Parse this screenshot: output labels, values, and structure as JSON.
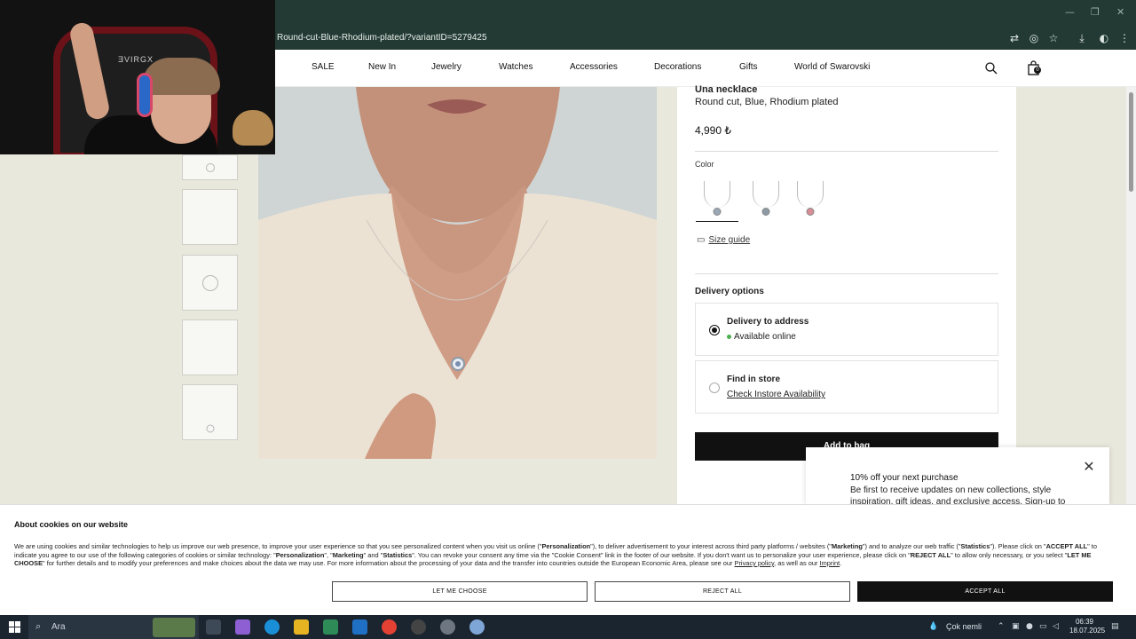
{
  "browser": {
    "url": "Round-cut-Blue-Rhodium-plated/?variantID=5279425",
    "window_controls": {
      "minimize": "—",
      "restore": "❐",
      "close": "✕"
    }
  },
  "nav": {
    "items": [
      "SALE",
      "New In",
      "Jewelry",
      "Watches",
      "Accessories",
      "Decorations",
      "Gifts",
      "World of Swarovski"
    ],
    "bag_count": "0"
  },
  "webcam": {
    "chair_brand": "ƎVIRGX"
  },
  "product": {
    "name": "Una necklace",
    "variant": "Round cut, Blue, Rhodium plated",
    "price": "4,990 ₺",
    "color_label": "Color",
    "swatch_colors": [
      "#9aa7b6",
      "#8e9aa3",
      "#d88d96"
    ],
    "size_guide": "Size guide",
    "delivery_label": "Delivery options",
    "delivery": [
      {
        "title": "Delivery to address",
        "sub": "Available online",
        "selected": true
      },
      {
        "title": "Find in store",
        "sub": "Check Instore Availability",
        "selected": false
      }
    ],
    "add_to_bag": "Add to bag"
  },
  "newsletter": {
    "title": "10% off your next purchase",
    "body": "Be first to receive updates on new collections, style inspiration, gift ideas, and exclusive access. Sign-up to"
  },
  "cookie": {
    "title": "About cookies on our website",
    "p1": "We are using cookies and similar technologies to help us improve our web presence, to improve your user experience so that you see personalized content when you visit us online (\"",
    "b1": "Personalization",
    "p2": "\"), to deliver advertisement to your interest across third party platforms / websites (\"",
    "b2": "Marketing",
    "p3": "\") and to analyze our web traffic (\"",
    "b3": "Statistics",
    "p4": "\"). Please click on \"",
    "b4": "ACCEPT ALL",
    "p5": "\" to indicate you agree to our use of the following categories of cookies or similar technology: \"",
    "b5": "Personalization",
    "p6": "\", \"",
    "b6": "Marketing",
    "p7": "\" and \"",
    "b7": "Statistics",
    "p8": "\". You can revoke your consent any time via the \"Cookie Consent\" link in the footer of our website. If you don't want us to personalize your user experience, please click on \"",
    "b8": "REJECT ALL",
    "p9": "\" to allow only necessary, or you select \"",
    "b9": "LET ME CHOOSE",
    "p10": "\" for further details and to modify your preferences and make choices about the data we may use. For more information  about the processing of your data and the transfer into countries outside the European Economic Area, please see our ",
    "link1": "Privacy policy",
    "p11": ", as well as our ",
    "link2": "Imprint",
    "p12": ".",
    "btn_choose": "LET ME CHOOSE",
    "btn_reject": "REJECT ALL",
    "btn_accept": "ACCEPT ALL"
  },
  "taskbar": {
    "search_placeholder": "Ara",
    "weather": "Çok nemli",
    "time": "06:39",
    "date": "18.07.2025"
  }
}
